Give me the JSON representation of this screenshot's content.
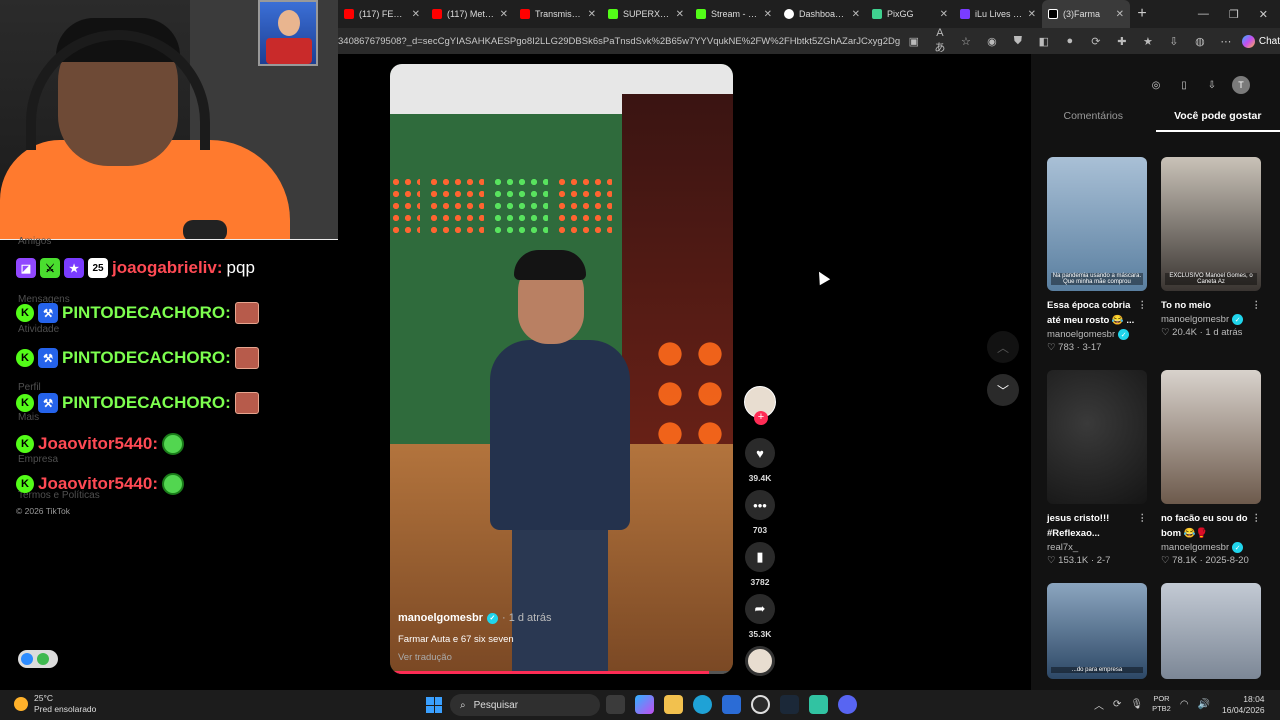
{
  "browser": {
    "tabs": [
      {
        "label": "(117) FEAR TH",
        "color": "#ff0000"
      },
      {
        "label": "(117) Metal In",
        "color": "#ff0000"
      },
      {
        "label": "Transmissão a",
        "color": "#ff0000"
      },
      {
        "label": "SUPERXANDA",
        "color": "#53fc18"
      },
      {
        "label": "Stream - Kick",
        "color": "#53fc18"
      },
      {
        "label": "Dashboard - L",
        "color": "#ffffff"
      },
      {
        "label": "PixGG",
        "color": "#3fd18f"
      },
      {
        "label": "iLu Lives | Rea",
        "color": "#7a3cff"
      },
      {
        "label": "(3)Farma",
        "color": "#ffffff"
      }
    ],
    "url": "340867679508?_d=secCgYIASAHKAESPgo8I2LLG29DBSk6sPaTnsdSvk%2B65w7YYVqukNE%2FW%2FHbtkt5ZGhAZarJCxyg2Dgn90oAhPn8iUc...",
    "chat_label": "Chat"
  },
  "stream": {
    "ghost_menu": [
      "Amigos",
      "Mensagens",
      "Atividade",
      "Perfil",
      "Mais",
      "Empresa",
      "Termos e Políticas"
    ],
    "chat": [
      {
        "user": "joaogabrieliv:",
        "message": "pqp",
        "style": "red"
      },
      {
        "user": "PINTODECACHORO:",
        "message": "",
        "style": "green"
      },
      {
        "user": "PINTODECACHORO:",
        "message": "",
        "style": "green"
      },
      {
        "user": "PINTODECACHORO:",
        "message": "",
        "style": "green"
      },
      {
        "user": "Joaovitor5440:",
        "message": "",
        "style": "red"
      },
      {
        "user": "Joaovitor5440:",
        "message": "",
        "style": "red"
      }
    ],
    "copyright": "© 2026 TikTok"
  },
  "video": {
    "author": "manoelgomesbr",
    "time": "· 1 d atrás",
    "caption": "Farmar Auta e 67 six seven",
    "translate": "Ver tradução",
    "progress": 0.93
  },
  "actions": {
    "likes": "39.4K",
    "comments": "703",
    "saves": "3782",
    "shares": "35.3K"
  },
  "right_panel": {
    "tabs": [
      "Comentários",
      "Você pode gostar"
    ],
    "avatar_letter": "T",
    "cards": [
      {
        "title": "Essa época cobria até meu rosto 😂 ...",
        "author": "manoelgomesbr",
        "verified": true,
        "meta": "♡ 783 · 3-17",
        "thumb": "#5a7fa0",
        "subtitle": "Na pandemia usando a máscara. Que minha mãe comprou"
      },
      {
        "title": "To no meio",
        "author": "manoelgomesbr",
        "verified": true,
        "meta": "♡ 20.4K · 1 d atrás",
        "thumb": "#8a7a6a",
        "subtitle": "EXCLUSIVO Manoel Gomes, o Caneta Az"
      },
      {
        "title": "jesus cristo!!! #Reflexao...",
        "author": "real7x_",
        "verified": false,
        "meta": "♡ 153.1K · 2-7",
        "thumb": "#2a2a2a",
        "subtitle": ""
      },
      {
        "title": "no facão eu sou do bom 😂🥊",
        "author": "manoelgomesbr",
        "verified": true,
        "meta": "♡ 78.1K · 2025-8-20",
        "thumb": "#8c7868",
        "subtitle": ""
      },
      {
        "title": "",
        "author": "",
        "verified": false,
        "meta": "",
        "thumb": "#4a6a8a",
        "subtitle": "...do para empresa"
      },
      {
        "title": "",
        "author": "",
        "verified": false,
        "meta": "",
        "thumb": "#b8c0cc",
        "subtitle": ""
      }
    ]
  },
  "taskbar": {
    "temp": "25°C",
    "weather": "Pred ensolarado",
    "search": "Pesquisar",
    "lang1": "POR",
    "lang2": "PTB2",
    "time": "18:04",
    "date": "16/04/2026"
  }
}
